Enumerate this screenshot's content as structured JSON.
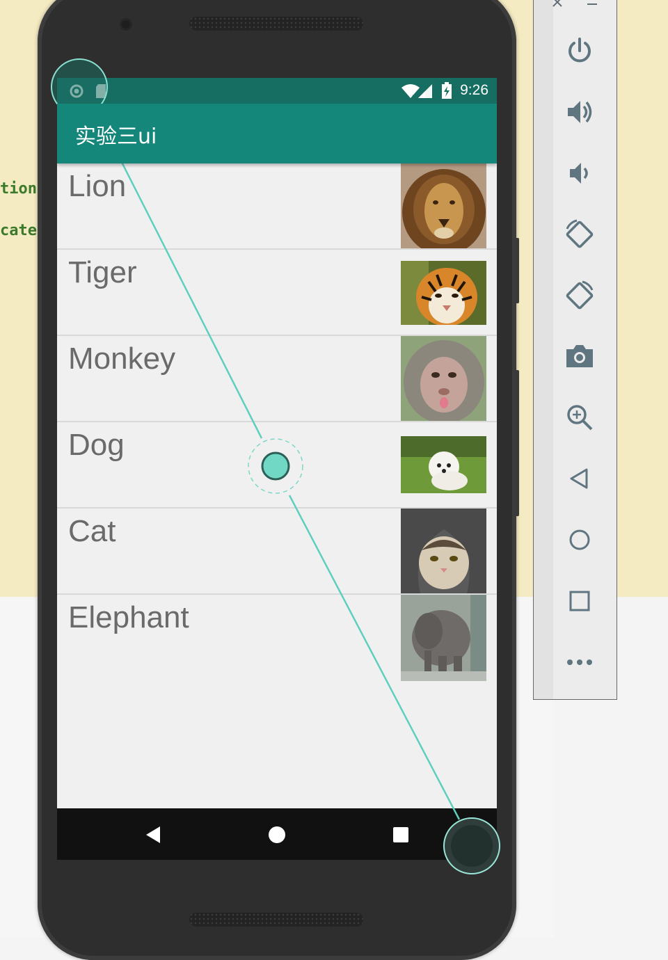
{
  "ide": {
    "code_lines": [
      "tion",
      "cate"
    ]
  },
  "status_bar": {
    "time": "9:26"
  },
  "app_bar": {
    "title": "实验三ui"
  },
  "animals": [
    {
      "label": "Lion",
      "image": "lion photo"
    },
    {
      "label": "Tiger",
      "image": "tiger photo"
    },
    {
      "label": "Monkey",
      "image": "monkey photo"
    },
    {
      "label": "Dog",
      "image": "dog photo"
    },
    {
      "label": "Cat",
      "image": "cat photo"
    },
    {
      "label": "Elephant",
      "image": "elephant photo"
    }
  ],
  "nav_bar": {
    "buttons": [
      "back-icon",
      "home-icon",
      "recents-icon"
    ]
  },
  "emulator_toolbar": {
    "window_controls": [
      "close-icon",
      "minimize-icon"
    ],
    "buttons": [
      "power-icon",
      "volume-up-icon",
      "volume-down-icon",
      "rotate-left-icon",
      "rotate-right-icon",
      "camera-icon",
      "zoom-icon",
      "back-icon",
      "home-icon",
      "overview-icon",
      "more-icon"
    ]
  },
  "colors": {
    "app_bar": "#15877a",
    "status_bar": "#166e62",
    "touch_accent": "#6fd6c4"
  }
}
